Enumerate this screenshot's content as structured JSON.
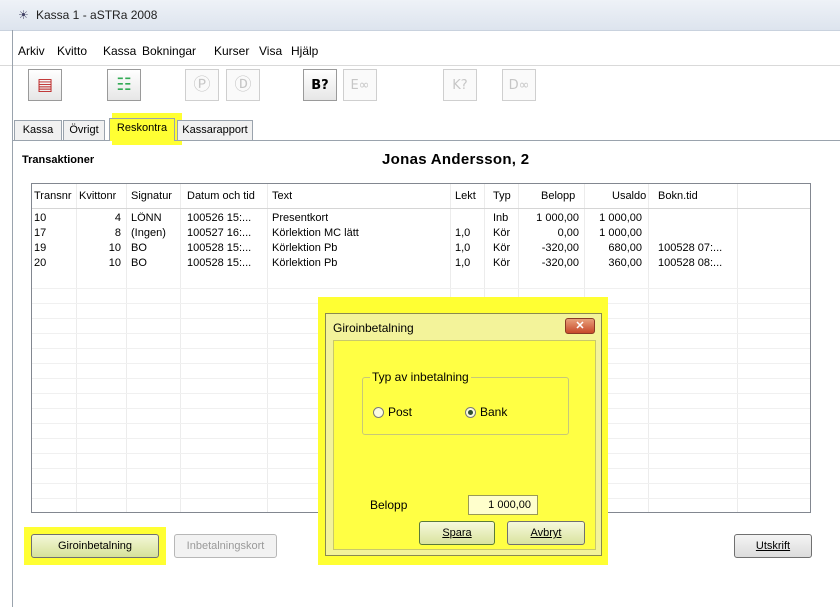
{
  "window": {
    "title": "Kassa 1 - aSTRa 2008"
  },
  "menu": [
    "Arkiv",
    "Kvitto",
    "Kassa",
    "Bokningar",
    "Kurser",
    "Visa",
    "Hjälp"
  ],
  "toolbar": [
    {
      "icon": "receipt-icon",
      "enabled": true
    },
    {
      "icon": "cart-icon",
      "enabled": true
    },
    {
      "icon": "search-e-icon",
      "enabled": false
    },
    {
      "icon": "search-d-icon",
      "enabled": false
    },
    {
      "icon": "booking-b-icon",
      "enabled": true
    },
    {
      "icon": "booking-e-icon",
      "enabled": false
    },
    {
      "icon": "booking-k-icon",
      "enabled": false
    },
    {
      "icon": "booking-d-icon",
      "enabled": false
    }
  ],
  "tabs": [
    "Kassa",
    "Övrigt",
    "Reskontra",
    "Kassarapport"
  ],
  "active_tab": "Reskontra",
  "section_title": "Transaktioner",
  "customer": "Jonas Andersson, 2",
  "table": {
    "columns": [
      "Transnr",
      "Kvittonr",
      "Signatur",
      "Datum och tid",
      "Text",
      "Lekt",
      "Typ",
      "Belopp",
      "Usaldo",
      "Bokn.tid"
    ],
    "rows": [
      [
        "10",
        "4",
        "LÖNN",
        "100526 15:...",
        "Presentkort",
        "",
        "Inb",
        "1 000,00",
        "1 000,00",
        ""
      ],
      [
        "17",
        "8",
        "(Ingen)",
        "100527 16:...",
        "Körlektion MC lätt",
        "1,0",
        "Kör",
        "0,00",
        "1 000,00",
        ""
      ],
      [
        "19",
        "10",
        "BO",
        "100528 15:...",
        "Körlektion Pb",
        "1,0",
        "Kör",
        "-320,00",
        "680,00",
        "100528 07:..."
      ],
      [
        "20",
        "10",
        "BO",
        "100528 15:...",
        "Körlektion Pb",
        "1,0",
        "Kör",
        "-320,00",
        "360,00",
        "100528 08:..."
      ]
    ]
  },
  "buttons": {
    "giro": "Giroinbetalning",
    "inbetalningskort": "Inbetalningskort",
    "utskrift": "Utskrift"
  },
  "dialog": {
    "title": "Giroinbetalning",
    "group_label": "Typ av inbetalning",
    "radio_post": "Post",
    "radio_bank": "Bank",
    "selected": "Bank",
    "amount_label": "Belopp",
    "amount_value": "1 000,00",
    "save": "Spara",
    "cancel": "Avbryt"
  },
  "highlight_color": "#ffff33"
}
